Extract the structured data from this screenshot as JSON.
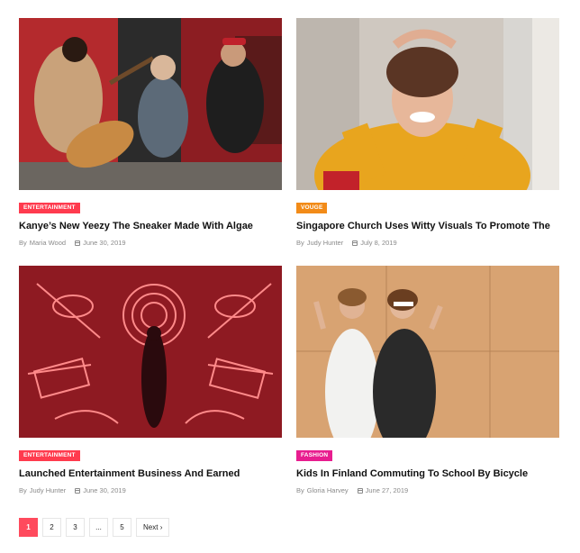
{
  "posts": [
    {
      "category": "ENTERTAINMENT",
      "category_color": "#ff3b4e",
      "title": "Kanye’s New Yeezy The Sneaker Made With Algae",
      "by": "By",
      "author": "Maria Wood",
      "date": "June 30, 2019"
    },
    {
      "category": "VOUGE",
      "category_color": "#f28b18",
      "title": "Singapore Church Uses Witty Visuals To Promote The",
      "by": "By",
      "author": "Judy Hunter",
      "date": "July 8, 2019"
    },
    {
      "category": "ENTERTAINMENT",
      "category_color": "#ff3b4e",
      "title": "Launched Entertainment Business And Earned",
      "by": "By",
      "author": "Judy Hunter",
      "date": "June 30, 2019"
    },
    {
      "category": "FASHION",
      "category_color": "#e81d8f",
      "title": "Kids In Finland Commuting To School By Bicycle",
      "by": "By",
      "author": "Gloria Harvey",
      "date": "June 27, 2019"
    }
  ],
  "pagination": {
    "pages": [
      "1",
      "2",
      "3",
      "...",
      "5"
    ],
    "current": "1",
    "next_label": "Next",
    "next_icon": "chevron-right-icon",
    "active_color": "#ff4a5d"
  }
}
